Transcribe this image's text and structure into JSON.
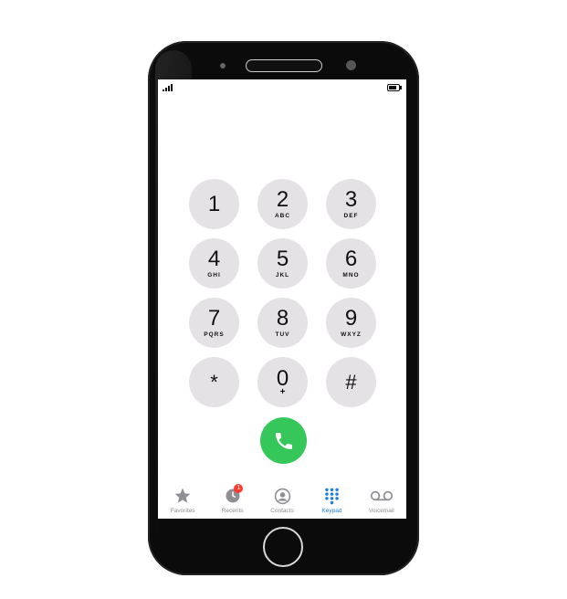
{
  "keypad": {
    "keys": [
      {
        "digit": "1",
        "letters": ""
      },
      {
        "digit": "2",
        "letters": "ABC"
      },
      {
        "digit": "3",
        "letters": "DEF"
      },
      {
        "digit": "4",
        "letters": "GHI"
      },
      {
        "digit": "5",
        "letters": "JKL"
      },
      {
        "digit": "6",
        "letters": "MNO"
      },
      {
        "digit": "7",
        "letters": "PQRS"
      },
      {
        "digit": "8",
        "letters": "TUV"
      },
      {
        "digit": "9",
        "letters": "WXYZ"
      },
      {
        "digit": "*",
        "letters": ""
      },
      {
        "digit": "0",
        "letters": "+"
      },
      {
        "digit": "#",
        "letters": ""
      }
    ],
    "call_icon": "phone-icon",
    "call_color": "#35c759"
  },
  "tabs": [
    {
      "label": "Favorites",
      "icon": "star-icon",
      "active": false
    },
    {
      "label": "Recents",
      "icon": "clock-icon",
      "active": false,
      "badge": "1"
    },
    {
      "label": "Contacts",
      "icon": "person-circle-icon",
      "active": false
    },
    {
      "label": "Keypad",
      "icon": "keypad-grid-icon",
      "active": true
    },
    {
      "label": "Voicemail",
      "icon": "voicemail-icon",
      "active": false
    }
  ],
  "colors": {
    "accent": "#1f7fe0",
    "inactive": "#8e8e93",
    "key_bg": "#e5e2e6",
    "badge": "#ff3b30"
  }
}
